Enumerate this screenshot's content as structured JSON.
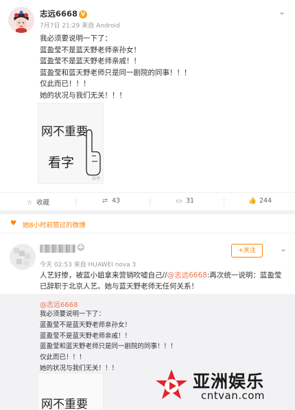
{
  "post": {
    "author": "志远6668",
    "verified_badge": "V",
    "meta": "7月7日 21:29 来自 Android",
    "lines": [
      "我必须要说明一下了：",
      "蓝盈莹不是蓝天野老师亲孙女！",
      "蓝盈莹不是蓝天野老师亲戚！！",
      "蓝盈莹和蓝天野老师只是同一剧院的同事！！！",
      "仅此而已！！！",
      "她的状况与我们无关！！！"
    ],
    "image_text_line1": "网不重要",
    "image_text_line2": "看字",
    "image_watermark": "微博",
    "actions": {
      "favorite_label": "收藏",
      "repost_count": "43",
      "comment_count": "31",
      "like_count": "244"
    }
  },
  "like_notice": "她8小时前赞过的微博",
  "post2": {
    "meta": "今天 02:53 来自 HUAWEI nova 3",
    "follow_label": "+关注",
    "text_before": "人艺好惨，被蓝小姐拿来营销吹嘘自己//",
    "mention": "@志远6668",
    "text_after": ":再次统一说明：蓝盈莹已辞职于北京人艺。她与蓝天野老师无任何关系！"
  },
  "quote": {
    "name": "@志远6668",
    "lines": [
      "我必须要说明一下了：",
      "蓝盈莹不是蓝天野老师亲孙女！",
      "蓝盈莹不是蓝天野老师亲戚！！",
      "蓝盈莹和蓝天野老师只是同一剧院的同事！！！",
      "仅此而已！！！",
      "她的状况与我们无关！！！"
    ],
    "image_text_line1": "网不重要"
  },
  "watermark_logo": {
    "cn": "亚洲娱乐",
    "en": "cntvan.com"
  },
  "colors": {
    "accent_orange": "#ff8200",
    "mention_color": "#eb7350",
    "verified_gold": "#f5a623",
    "logo_red": "#e3232b"
  },
  "icons": [
    "chevron-down-icon",
    "favorite-icon",
    "repost-icon",
    "comment-icon",
    "like-icon",
    "heart-icon",
    "smile-emoji-icon"
  ]
}
